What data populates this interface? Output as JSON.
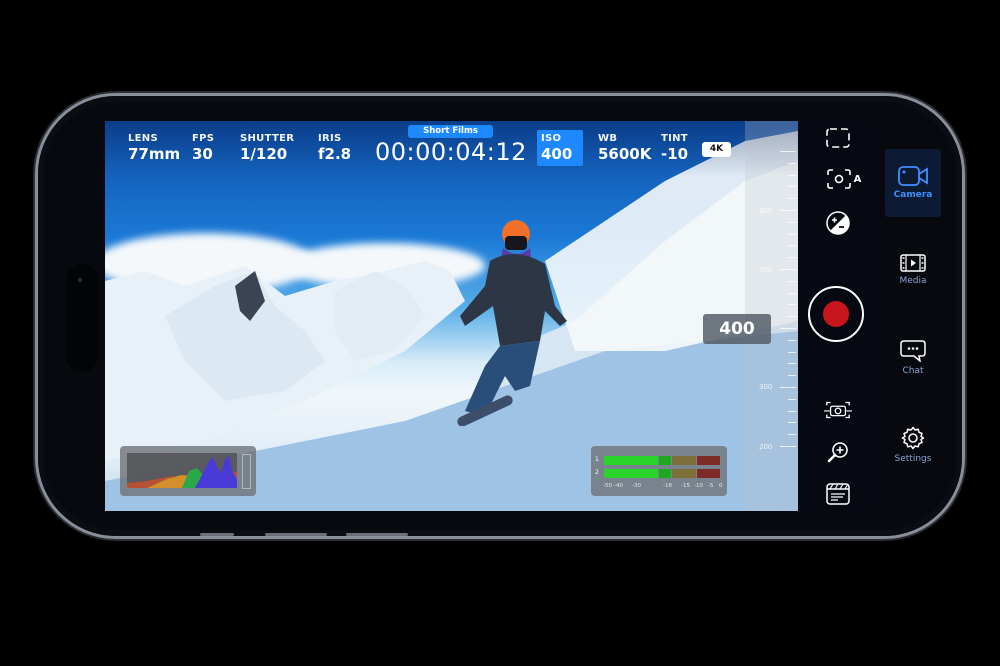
{
  "app": {
    "project_name": "Short Films",
    "timecode": "00:00:04:12",
    "resolution_badge": "4K"
  },
  "stats": [
    {
      "key": "lens",
      "label": "LENS",
      "value": "77mm"
    },
    {
      "key": "fps",
      "label": "FPS",
      "value": "30"
    },
    {
      "key": "shutter",
      "label": "SHUTTER",
      "value": "1/120"
    },
    {
      "key": "iris",
      "label": "IRIS",
      "value": "f2.8"
    },
    {
      "key": "iso",
      "label": "ISO",
      "value": "400",
      "selected": true
    },
    {
      "key": "wb",
      "label": "WB",
      "value": "5600K"
    },
    {
      "key": "tint",
      "label": "TINT",
      "value": "-10"
    }
  ],
  "iso_scale": {
    "current_value": "400",
    "tick_labels": [
      "600",
      "500",
      "300",
      "200"
    ]
  },
  "audio_meter": {
    "channels": [
      "1",
      "2"
    ],
    "db_labels": [
      "-50",
      "-40",
      "-30",
      "-18",
      "-15",
      "-10",
      "-5",
      "0"
    ]
  },
  "controls": [
    {
      "name": "frame-guides",
      "icon": "frame-guides-icon"
    },
    {
      "name": "auto-focus",
      "icon": "focus-auto-icon",
      "badge": "A"
    },
    {
      "name": "exposure",
      "icon": "exposure-icon"
    },
    {
      "name": "record",
      "icon": "record-icon"
    },
    {
      "name": "stabilization",
      "icon": "stabilization-icon"
    },
    {
      "name": "zoom",
      "icon": "zoom-in-icon"
    },
    {
      "name": "clip-info",
      "icon": "clapperboard-icon"
    }
  ],
  "tabs": [
    {
      "label": "Camera",
      "icon": "video-camera-icon",
      "active": true
    },
    {
      "label": "Media",
      "icon": "film-icon",
      "active": false
    },
    {
      "label": "Chat",
      "icon": "chat-icon",
      "active": false
    },
    {
      "label": "Settings",
      "icon": "gear-icon",
      "active": false
    }
  ],
  "colors": {
    "accent": "#1e88ff",
    "record": "#c8151b",
    "tab_active": "#3f8fff",
    "tab_inactive": "#8aa4d0"
  }
}
